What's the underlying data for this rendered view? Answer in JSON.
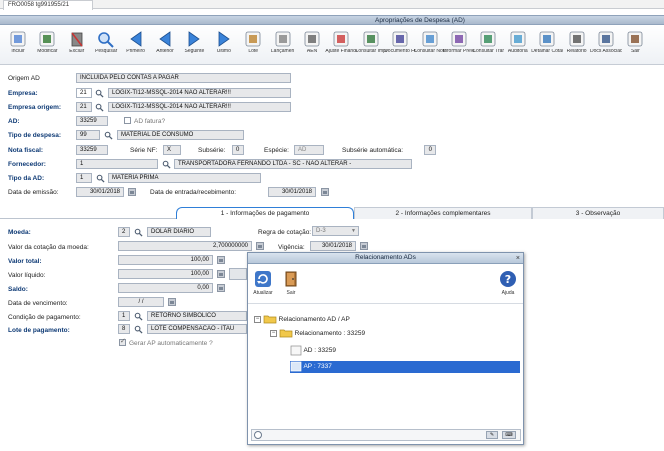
{
  "tab": {
    "label": "FRO0058 tg991955/21"
  },
  "window": {
    "title": "Apropriações de Despesa (AD)"
  },
  "toolbar": [
    {
      "label": "Incluir",
      "icon": "include-icon"
    },
    {
      "label": "Modificar",
      "icon": "edit-icon"
    },
    {
      "label": "Excluir",
      "icon": "delete-icon"
    },
    {
      "label": "Pesquisar",
      "icon": "search-icon"
    },
    {
      "label": "Primeiro",
      "icon": "first-icon"
    },
    {
      "label": "Anterior",
      "icon": "previous-icon"
    },
    {
      "label": "Seguinte",
      "icon": "next-icon"
    },
    {
      "label": "Último",
      "icon": "last-icon"
    },
    {
      "label": "Lote",
      "icon": "batch-icon"
    },
    {
      "label": "Lançamen",
      "icon": "entries-icon"
    },
    {
      "label": "AEN",
      "icon": "aen-icon"
    },
    {
      "label": "Ajuste Financeiro",
      "icon": "financial-adjust-icon"
    },
    {
      "label": "Consultar Impostos",
      "icon": "taxes-icon"
    },
    {
      "label": "Documento Fiscais",
      "icon": "tax-document-icon"
    },
    {
      "label": "Consultar Nota",
      "icon": "invoice-icon"
    },
    {
      "label": "Informar Previsão",
      "icon": "forecast-icon"
    },
    {
      "label": "Consultar Transf.",
      "icon": "transfer-icon"
    },
    {
      "label": "Auditoria",
      "icon": "audit-icon"
    },
    {
      "label": "Detalhar Cotação",
      "icon": "quote-icon"
    },
    {
      "label": "Relatório",
      "icon": "report-icon"
    },
    {
      "label": "Docs Associados",
      "icon": "attached-docs-icon"
    },
    {
      "label": "Sair",
      "icon": "exit-icon"
    }
  ],
  "form": {
    "origem_label": "Origem AD",
    "origem_value": "INCLUIDA PELO CONTAS A PAGAR",
    "empresa_label": "Empresa:",
    "empresa_code": "21",
    "empresa_name": "LOGIX-TI12-MSSQL-2014 NÃO ALTERAR!!!",
    "empresa_origem_label": "Empresa origem:",
    "empresa_origem_code": "21",
    "empresa_origem_name": "LOGIX-TI12-MSSQL-2014 NÃO ALTERAR!!!",
    "ad_label": "AD:",
    "ad_value": "33259",
    "ad_fatura_label": "AD fatura?",
    "tipo_despesa_label": "Tipo de despesa:",
    "tipo_despesa_code": "99",
    "tipo_despesa_name": "MATERIAL DE CONSUMO",
    "nota_fiscal_label": "Nota fiscal:",
    "nota_fiscal_value": "33259",
    "serie_label": "Série NF:",
    "serie_value": "X",
    "subserie_label": "Subsérie:",
    "subserie_value": "0",
    "especie_label": "Espécie:",
    "especie_value": "AD",
    "subserie_auto_label": "Subsérie automática:",
    "subserie_auto_value": "0",
    "fornecedor_label": "Fornecedor:",
    "fornecedor_code": "1",
    "fornecedor_name": "TRANSPORTADORA FERNANDO LTDA - SC - NAO ALTERAR -",
    "tipo_ad_label": "Tipo da AD:",
    "tipo_ad_code": "1",
    "tipo_ad_name": "MATERIA PRIMA",
    "data_emissao_label": "Data de emissão:",
    "data_emissao_value": "30/01/2018",
    "data_entrada_label": "Data de entrada/recebimento:",
    "data_entrada_value": "30/01/2018"
  },
  "page_tabs": [
    {
      "label": "1 - Informações de pagamento"
    },
    {
      "label": "2 - Informações complementares"
    },
    {
      "label": "3 - Observação"
    }
  ],
  "payment": {
    "moeda_label": "Moeda:",
    "moeda_code": "2",
    "moeda_name": "DOLAR DIARIO",
    "regra_label": "Regra de cotação:",
    "regra_value": "D-3",
    "valor_cotacao_label": "Valor da cotação da moeda:",
    "valor_cotacao_value": "2,700000000",
    "vigencia_label": "Vigência:",
    "vigencia_value": "30/01/2018",
    "valor_total_label": "Valor total:",
    "valor_total_value": "100,00",
    "valor_liquido_label": "Valor líquido:",
    "valor_liquido_value": "100,00",
    "saldo_label": "Saldo:",
    "saldo_value": "0,00",
    "data_vencimento_label": "Data de vencimento:",
    "data_vencimento_value": "/ /",
    "condicao_label": "Condição de pagamento:",
    "condicao_code": "1",
    "condicao_name": "RETORNO SIMBÓLICO",
    "lote_label": "Lote de pagamento:",
    "lote_code": "8",
    "lote_name": "LOTE COMPENSACAO - ITAU",
    "gerar_ap_label": "Gerar AP automaticamente ?"
  },
  "dialog": {
    "title": "Relacionamento ADs",
    "atualizar": "Atualizar",
    "sair": "Sair",
    "ajuda": "Ajuda",
    "tree": {
      "root": "Relacionamento AD / AP",
      "child": "Relacionamento : 33259",
      "ad": "AD : 33259",
      "ap": "AP : 7337"
    }
  }
}
